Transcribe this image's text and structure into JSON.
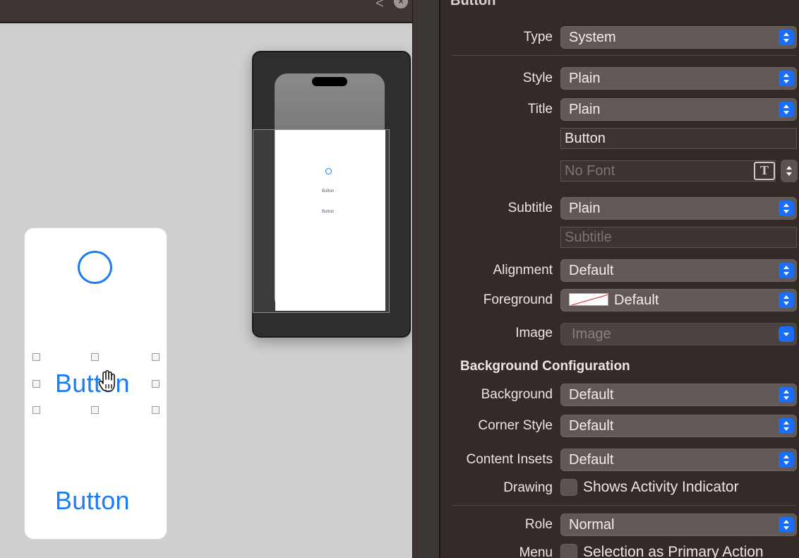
{
  "canvas": {
    "nav_back": "<",
    "nav_close": "×",
    "nav_forward": ">",
    "scene_button_1": "Button",
    "scene_button_2": "Button",
    "preview_button_1": "Button",
    "preview_button_2": "Button"
  },
  "inspector": {
    "title": "Button",
    "type": {
      "label": "Type",
      "value": "System"
    },
    "style": {
      "label": "Style",
      "value": "Plain"
    },
    "title_row": {
      "label": "Title",
      "value": "Plain"
    },
    "title_text": "Button",
    "font_placeholder": "No Font",
    "font_icon": "T",
    "subtitle": {
      "label": "Subtitle",
      "value": "Plain"
    },
    "subtitle_placeholder": "Subtitle",
    "alignment": {
      "label": "Alignment",
      "value": "Default"
    },
    "foreground": {
      "label": "Foreground",
      "value": "Default"
    },
    "image": {
      "label": "Image",
      "value": "Image"
    },
    "background_section": "Background Configuration",
    "background": {
      "label": "Background",
      "value": "Default"
    },
    "corner_style": {
      "label": "Corner Style",
      "value": "Default"
    },
    "content_insets": {
      "label": "Content Insets",
      "value": "Default"
    },
    "drawing": {
      "label": "Drawing",
      "checkbox_label": "Shows Activity Indicator"
    },
    "role": {
      "label": "Role",
      "value": "Normal"
    },
    "menu": {
      "label": "Menu",
      "checkbox_label": "Selection as Primary Action"
    }
  },
  "colors": {
    "accent": "#1d7cf2",
    "popup_chevron": "#1a6ef5",
    "inspector_bg": "#332b28"
  }
}
